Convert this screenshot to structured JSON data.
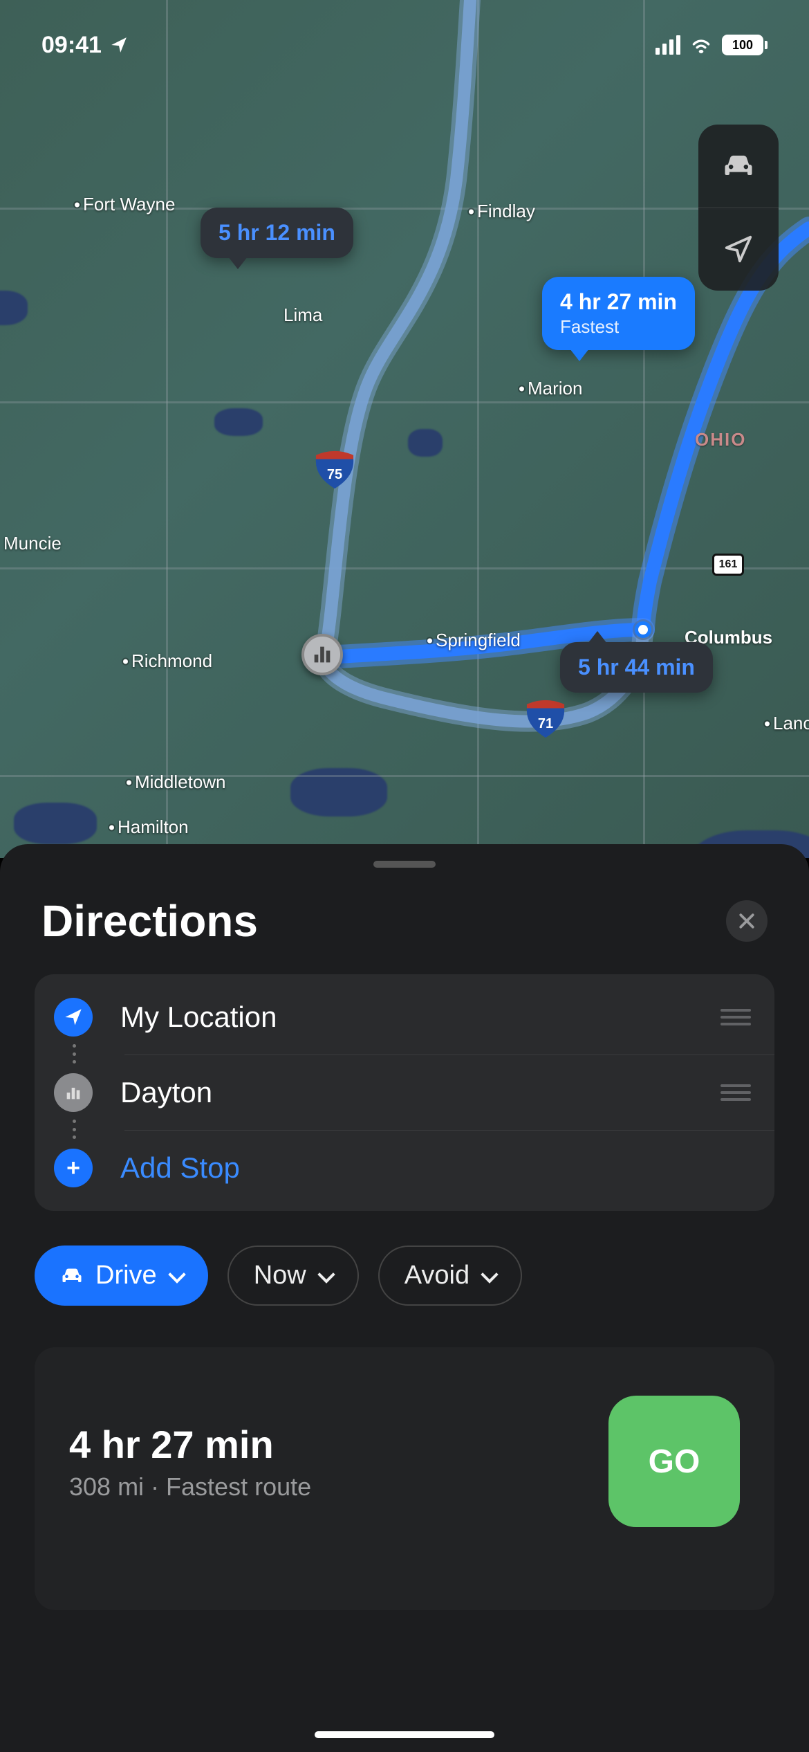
{
  "status": {
    "time": "09:41",
    "battery": "100"
  },
  "map": {
    "cities": {
      "fort_wayne": "Fort Wayne",
      "findlay": "Findlay",
      "lima": "Lima",
      "muncie": "Muncie",
      "richmond": "Richmond",
      "springfield": "Springfield",
      "middletown": "Middletown",
      "hamilton": "Hamilton",
      "marion": "Marion",
      "lancaster": "Lanc",
      "columbus": "Columbus"
    },
    "state_label": "OHIO",
    "interstates": {
      "i75": "75",
      "i71": "71"
    },
    "route_shield_161": "161",
    "callouts": {
      "alt_north": "5 hr 12 min",
      "fastest_time": "4 hr 27 min",
      "fastest_sub": "Fastest",
      "alt_south": "5 hr 44 min"
    }
  },
  "sheet": {
    "title": "Directions",
    "stops": {
      "from": "My Location",
      "to": "Dayton",
      "add": "Add Stop"
    },
    "chips": {
      "mode": "Drive",
      "when": "Now",
      "avoid": "Avoid"
    },
    "route": {
      "duration": "4 hr 27 min",
      "meta": "308 mi · Fastest route",
      "go": "GO"
    }
  }
}
